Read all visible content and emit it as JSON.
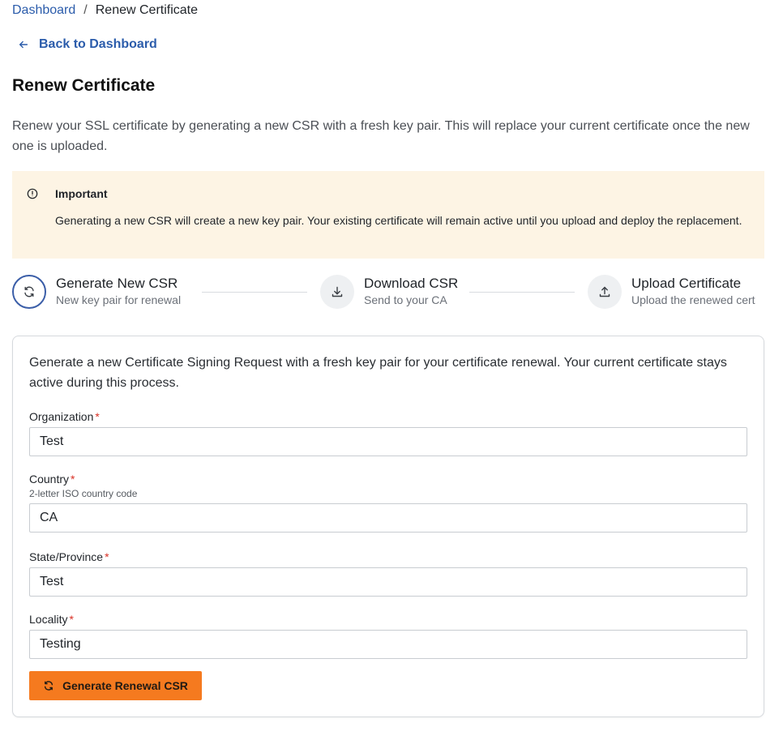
{
  "breadcrumb": {
    "home": "Dashboard",
    "separator": "/",
    "current": "Renew Certificate"
  },
  "back_link": "Back to Dashboard",
  "page_title": "Renew Certificate",
  "intro": "Renew your SSL certificate by generating a new CSR with a fresh key pair. This will replace your current certificate once the new one is uploaded.",
  "alert": {
    "title": "Important",
    "body": "Generating a new CSR will create a new key pair. Your existing certificate will remain active until you upload and deploy the replacement."
  },
  "steps": [
    {
      "title": "Generate New CSR",
      "subtitle": "New key pair for renewal",
      "icon": "refresh-icon",
      "active": true
    },
    {
      "title": "Download CSR",
      "subtitle": "Send to your CA",
      "icon": "download-icon",
      "active": false
    },
    {
      "title": "Upload Certificate",
      "subtitle": "Upload the renewed cert",
      "icon": "upload-icon",
      "active": false
    }
  ],
  "form": {
    "description": "Generate a new Certificate Signing Request with a fresh key pair for your certificate renewal. Your current certificate stays active during this process.",
    "required_marker": "*",
    "organization": {
      "label": "Organization",
      "value": "Test"
    },
    "country": {
      "label": "Country",
      "hint": "2-letter ISO country code",
      "value": "CA"
    },
    "state": {
      "label": "State/Province",
      "value": "Test"
    },
    "locality": {
      "label": "Locality",
      "value": "Testing"
    },
    "submit_label": "Generate Renewal CSR"
  },
  "colors": {
    "link": "#2b5cab",
    "alert_bg": "#fdf4e4",
    "primary_button": "#f57a1f",
    "required": "#d93025",
    "active_step_border": "#3b5ea8"
  }
}
